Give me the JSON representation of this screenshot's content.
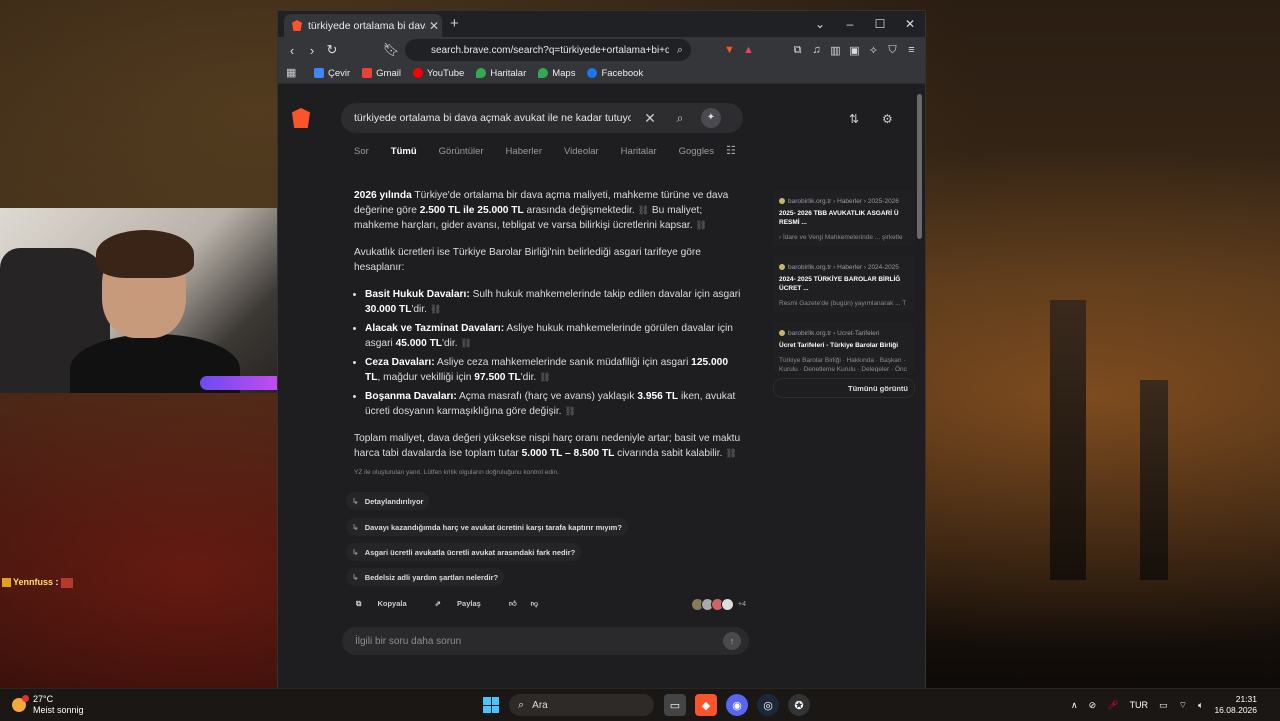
{
  "browser": {
    "tab_title": "türkiyede ortalama bi dava açmak avukat ile ne kadar tutuyor",
    "new_tab": "+",
    "window_controls": {
      "min": "⌄",
      "minimize": "–",
      "maximize": "☐",
      "close": "✕"
    },
    "url": "search.brave.com/search?q=türkiyede+ortalama+bi+dava+açmak+avukat+ile+ne+kadar+tutuyor",
    "bookmarks": [
      {
        "label": "Çevir",
        "color": "#4285f4"
      },
      {
        "label": "Gmail",
        "color": "#ea4335"
      },
      {
        "label": "YouTube",
        "color": "#ff0000"
      },
      {
        "label": "Haritalar",
        "color": "#34a853"
      },
      {
        "label": "Maps",
        "color": "#34a853"
      },
      {
        "label": "Facebook",
        "color": "#1877f2"
      }
    ]
  },
  "search": {
    "query": "türkiyede ortalama bi dava açmak avukat ile ne kadar tutuyor",
    "clear_icon": "✕",
    "search_icon": "⌕",
    "tabs": [
      "Sor",
      "Tümü",
      "Görüntüler",
      "Haberler",
      "Videolar",
      "Haritalar",
      "Goggles"
    ],
    "active_tab": "Tümü"
  },
  "answer": {
    "p1_b1": "2026 yılında",
    "p1_t1": " Türkiye'de ortalama bir dava açma maliyeti, mahkeme türüne ve dava değerine göre ",
    "p1_b2": "2.500 TL ile 25.000 TL",
    "p1_t2": " arasında değişmektedir.",
    "p1_t3": " Bu maliyet; mahkeme harçları, gider avansı, tebligat ve varsa bilirkişi ücretlerini kapsar.",
    "p2": "Avukatlık ücretleri ise Türkiye Barolar Birliği'nin belirlediği asgari tarifeye göre hesaplanır:",
    "items": [
      {
        "b": "Basit Hukuk Davaları:",
        "t": " Sulh hukuk mahkemelerinde takip edilen davalar için asgari ",
        "b2": "30.000 TL",
        "t2": "'dir."
      },
      {
        "b": "Alacak ve Tazminat Davaları:",
        "t": " Asliye hukuk mahkemelerinde görülen davalar için asgari ",
        "b2": "45.000 TL",
        "t2": "'dir."
      },
      {
        "b": "Ceza Davaları:",
        "t": " Asliye ceza mahkemelerinde sanık müdafiliği için asgari ",
        "b2": "125.000 TL",
        "t2": ", mağdur vekilliği için ",
        "b3": "97.500 TL",
        "t3": "'dir."
      },
      {
        "b": "Boşanma Davaları:",
        "t": " Açma masrafı (harç ve avans) yaklaşık ",
        "b2": "3.956 TL",
        "t2": " iken, avukat ücreti dosyanın karmaşıklığına göre değişir."
      }
    ],
    "p3_t1": "Toplam maliyet, dava değeri yüksekse nispi harç oranı nedeniyle artar; basit ve maktu harca tabi davalarda ise toplam tutar ",
    "p3_b": "5.000 TL – 8.500 TL",
    "p3_t2": " civarında sabit kalabilir.",
    "note": "YZ ile oluşturulan yanıt. Lütfen kritik olguların doğruluğunu kontrol edin.",
    "followups": [
      "Detaylandırılıyor",
      "Davayı kazandığımda harç ve avukat ücretini karşı tarafa kaptırır mıyım?",
      "Asgari ücretli avukatla ücretli avukat arasındaki fark nedir?",
      "Bedelsiz adli yardım şartları nelerdir?"
    ],
    "copy": "Kopyala",
    "share": "Paylaş",
    "more_count": "+4",
    "followup_placeholder": "İlgili bir soru daha sorun"
  },
  "sources": [
    {
      "site": "barobirlik.org.tr › Haberler › 2025-2026",
      "title1": "2025- 2026 TBB AVUKATLIK ASGARİ Ü",
      "title2": "RESMİ ...",
      "desc": "› İdare ve Vergi Mahkemelerinde ... şirketle"
    },
    {
      "site": "barobirlik.org.tr › Haberler › 2024-2025",
      "title1": "2024- 2025 TÜRKİYE BAROLAR BİRLİĞ",
      "title2": "ÜCRET ...",
      "desc": "Resmi Gazete'de (bugün) yayımlanarak ... T"
    },
    {
      "site": "barobirlik.org.tr › Ucret-Tarifeleri",
      "title1": "Ücret Tarifeleri - Türkiye Barolar Birliği",
      "title2": "",
      "desc": "Türkiye Barolar Birliği · Hakkında · Başkan · Kurulu · Denetleme Kurulu · Delegeler · Önc"
    }
  ],
  "see_all": "Tümünü görüntü",
  "stream": {
    "chat_name": "Yennfuss",
    "chat_sep": ":"
  },
  "taskbar": {
    "temp": "27°C",
    "weather": "Meist sonnig",
    "search_label": "Ara",
    "lang": "TUR",
    "time": "21:31",
    "date": "16.08.2026"
  }
}
